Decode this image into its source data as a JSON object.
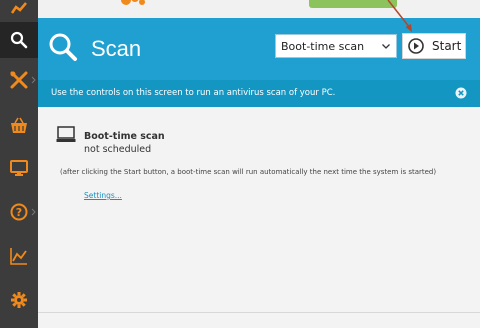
{
  "header": {
    "title": "Scan",
    "scan_type_selected": "Boot-time scan",
    "start_label": "Start"
  },
  "info_bar": {
    "text": "Use the controls on this screen to run an antivirus scan of your PC."
  },
  "content": {
    "boot_title": "Boot-time scan",
    "boot_status": "not scheduled",
    "note": "(after clicking the Start button, a boot-time scan will run automatically the next time the system is started)",
    "settings_link": "Settings..."
  },
  "sidebar": {
    "items": [
      {
        "icon": "status-icon"
      },
      {
        "icon": "search-icon"
      },
      {
        "icon": "tools-icon"
      },
      {
        "icon": "store-icon"
      },
      {
        "icon": "monitor-icon"
      },
      {
        "icon": "help-icon"
      },
      {
        "icon": "statistics-icon"
      },
      {
        "icon": "settings-gear-icon"
      }
    ]
  },
  "colors": {
    "header_blue": "#1fa0d0",
    "info_blue": "#1396c2",
    "sidebar_dark": "#3c3c3c",
    "accent_orange": "#f08a1c",
    "link_blue": "#1a8fc0"
  }
}
